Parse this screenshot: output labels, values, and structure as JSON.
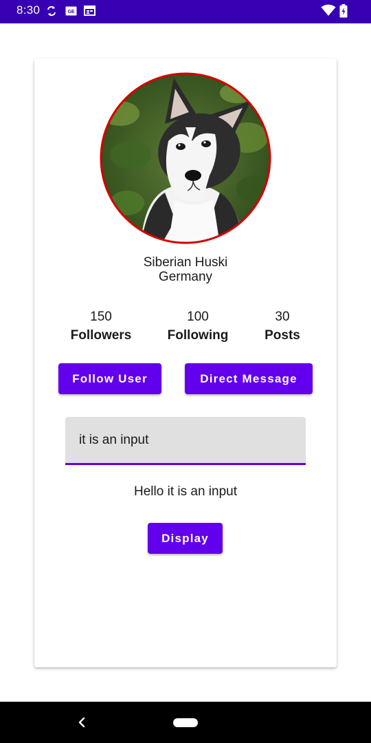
{
  "status_bar": {
    "time": "8:30",
    "background": "#3700b3",
    "icons": [
      "sync-icon",
      "sim-card-icon",
      "calendar-icon",
      "wifi-icon",
      "battery-icon"
    ]
  },
  "profile": {
    "name": "Siberian Huski",
    "country": "Germany",
    "avatar_icon": "husky-avatar-image",
    "avatar_border_color": "#d50000"
  },
  "stats": [
    {
      "value": "150",
      "label": "Followers"
    },
    {
      "value": "100",
      "label": "Following"
    },
    {
      "value": "30",
      "label": "Posts"
    }
  ],
  "actions": {
    "follow_label": "Follow User",
    "message_label": "Direct Message"
  },
  "input": {
    "value": "it is an input"
  },
  "output": {
    "text": "Hello it is an input"
  },
  "display_button": {
    "label": "Display"
  },
  "theme": {
    "primary": "#6200ee",
    "primary_dark": "#3700b3"
  },
  "nav_bar": {
    "icons": [
      "back-icon",
      "home-pill-icon"
    ]
  }
}
